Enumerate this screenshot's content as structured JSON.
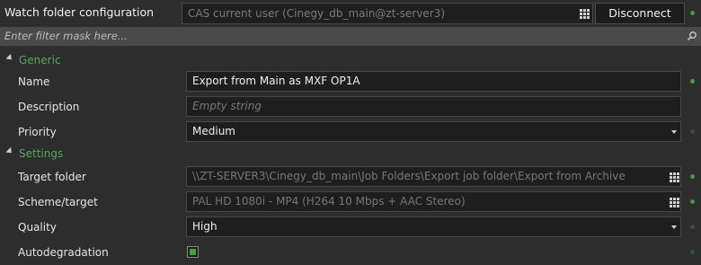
{
  "header": {
    "title": "Watch folder configuration",
    "connection_placeholder": "CAS current user (Cinegy_db_main@zt-server3)",
    "disconnect_label": "Disconnect"
  },
  "filter": {
    "placeholder": "Enter filter mask here..."
  },
  "sections": {
    "generic": {
      "label": "Generic",
      "name": {
        "label": "Name",
        "value": "Export from Main as MXF OP1A"
      },
      "description": {
        "label": "Description",
        "placeholder": "Empty string"
      },
      "priority": {
        "label": "Priority",
        "value": "Medium"
      }
    },
    "settings": {
      "label": "Settings",
      "target_folder": {
        "label": "Target folder",
        "value": "\\\\ZT-SERVER3\\Cinegy_db_main\\Job Folders\\Export job folder\\Export from Archive"
      },
      "scheme_target": {
        "label": "Scheme/target",
        "value": "PAL HD 1080i - MP4 (H264 10 Mbps + AAC Stereo)"
      },
      "quality": {
        "label": "Quality",
        "value": "High"
      },
      "autodegradation": {
        "label": "Autodegradation",
        "checked": true
      }
    }
  },
  "colors": {
    "accent_green": "#58a85a",
    "status_dot": "#3f9e3f",
    "background": "#2d2d2d"
  },
  "icons": [
    "grid-icon",
    "search-icon",
    "collapse-triangle-icon",
    "dropdown-caret-icon",
    "status-dot"
  ]
}
